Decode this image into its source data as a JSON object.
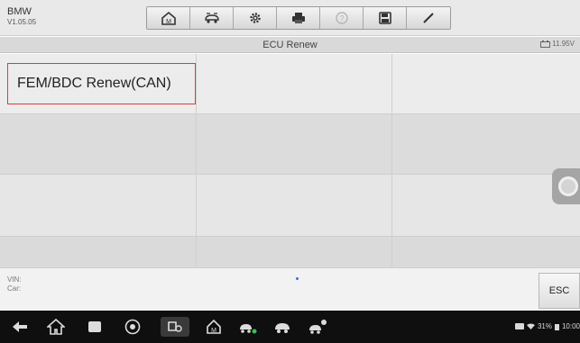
{
  "header": {
    "brand": "BMW",
    "version": "V1.05.05",
    "toolbar": [
      {
        "name": "home-button",
        "icon": "home-icon"
      },
      {
        "name": "vehicle-swap-button",
        "icon": "car-swap-icon"
      },
      {
        "name": "settings-button",
        "icon": "gear-icon"
      },
      {
        "name": "print-button",
        "icon": "printer-icon"
      },
      {
        "name": "help-button",
        "icon": "help-icon"
      },
      {
        "name": "save-button",
        "icon": "save-icon"
      },
      {
        "name": "edit-button",
        "icon": "pen-icon"
      }
    ]
  },
  "titlebar": {
    "title": "ECU Renew",
    "battery": "11.95V"
  },
  "grid": {
    "items": [
      "FEM/BDC Renew(CAN)"
    ]
  },
  "info": {
    "vin_label": "VIN:",
    "car_label": "Car:",
    "esc_label": "ESC"
  },
  "system_bar": {
    "status": "31%",
    "time": "10:00"
  }
}
